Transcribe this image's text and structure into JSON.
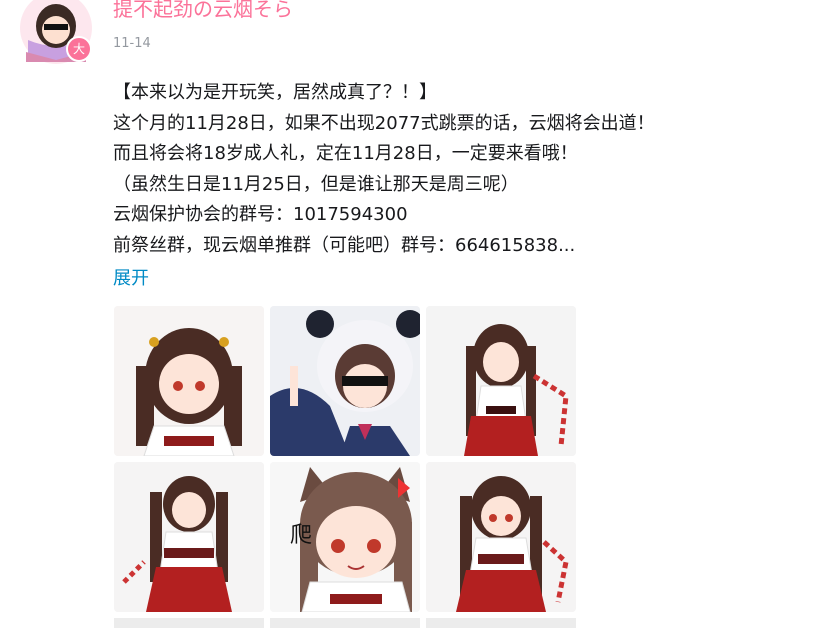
{
  "post": {
    "author": "提不起劲の云烟そら",
    "date": "11-14",
    "level_badge": "大",
    "lines": [
      "【本来以为是开玩笑，居然成真了？！】",
      "这个月的11月28日，如果不出现2077式跳票的话，云烟将会出道！",
      "而且将会将18岁成人礼，定在11月28日，一定要来看哦！",
      "（虽然生日是11月25日，但是谁让那天是周三呢）",
      "云烟保护协会的群号：1017594300",
      "前祭丝群，现云烟单推群（可能吧）群号：664615838..."
    ],
    "expand_label": "展开",
    "sticker_text": "爬"
  },
  "colors": {
    "author": "#fb7299",
    "link": "#008ac5",
    "date": "#9499a0",
    "text": "#18191c"
  }
}
